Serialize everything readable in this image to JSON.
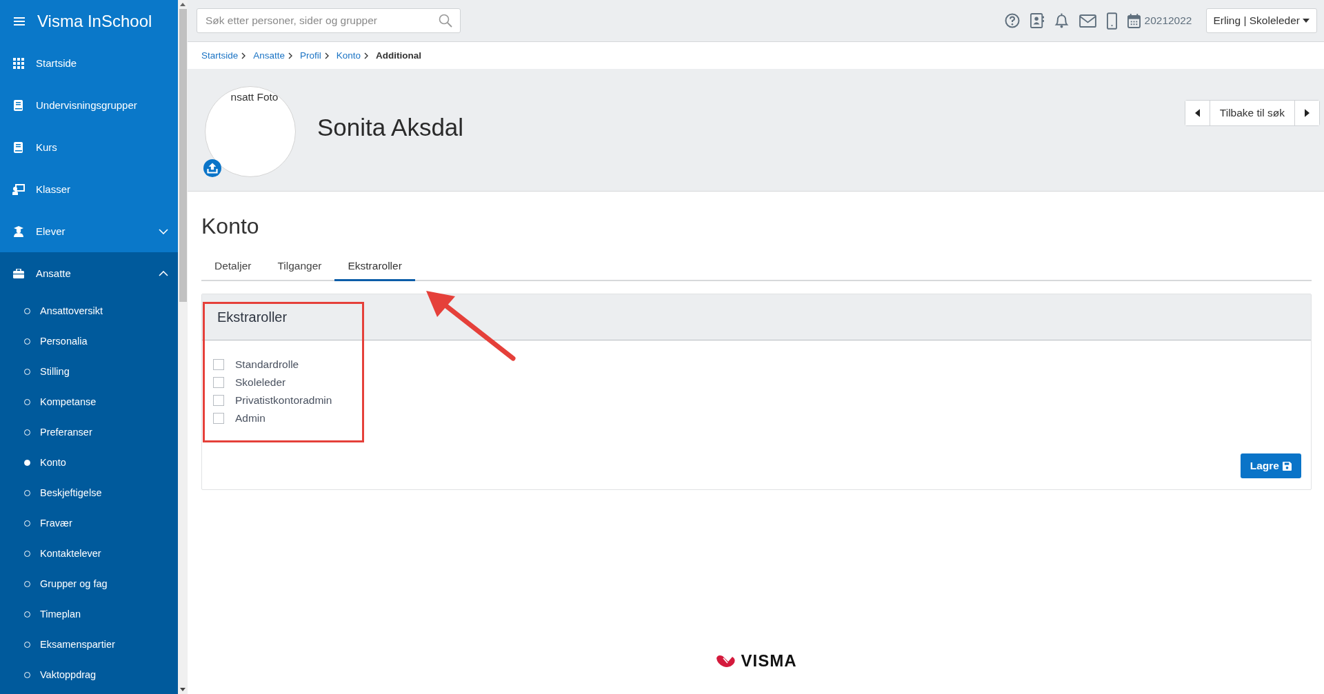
{
  "app": {
    "title": "Visma InSchool"
  },
  "sidebar": {
    "items": [
      {
        "label": "Startside"
      },
      {
        "label": "Undervisningsgrupper"
      },
      {
        "label": "Kurs"
      },
      {
        "label": "Klasser"
      },
      {
        "label": "Elever",
        "expanded": false
      },
      {
        "label": "Ansatte",
        "expanded": true,
        "children": [
          {
            "label": "Ansattoversikt",
            "selected": false
          },
          {
            "label": "Personalia",
            "selected": false
          },
          {
            "label": "Stilling",
            "selected": false
          },
          {
            "label": "Kompetanse",
            "selected": false
          },
          {
            "label": "Preferanser",
            "selected": false
          },
          {
            "label": "Konto",
            "selected": true
          },
          {
            "label": "Beskjeftigelse",
            "selected": false
          },
          {
            "label": "Fravær",
            "selected": false
          },
          {
            "label": "Kontaktelever",
            "selected": false
          },
          {
            "label": "Grupper og fag",
            "selected": false
          },
          {
            "label": "Timeplan",
            "selected": false
          },
          {
            "label": "Eksamenspartier",
            "selected": false
          },
          {
            "label": "Vaktoppdrag",
            "selected": false
          }
        ]
      }
    ]
  },
  "search": {
    "placeholder": "Søk etter personer, sider og grupper"
  },
  "school_year": "20212022",
  "user_menu": "Erling | Skoleleder",
  "breadcrumb": [
    "Startside",
    "Ansatte",
    "Profil",
    "Konto",
    "Additional"
  ],
  "profile": {
    "photo_label": "nsatt Foto",
    "name": "Sonita Aksdal",
    "back_button": "Tilbake til søk"
  },
  "page_title": "Konto",
  "tabs": [
    {
      "label": "Detaljer",
      "selected": false
    },
    {
      "label": "Tilganger",
      "selected": false
    },
    {
      "label": "Ekstraroller",
      "selected": true
    }
  ],
  "panel": {
    "title": "Ekstraroller",
    "roles": [
      {
        "label": "Standardrolle",
        "checked": false
      },
      {
        "label": "Skoleleder",
        "checked": false
      },
      {
        "label": "Privatistkontoradmin",
        "checked": false
      },
      {
        "label": "Admin",
        "checked": false
      }
    ],
    "save_button": "Lagre"
  },
  "annotations": [
    {
      "kind": "highlight-box"
    },
    {
      "kind": "arrow"
    }
  ],
  "footer_logo": "VISMA"
}
